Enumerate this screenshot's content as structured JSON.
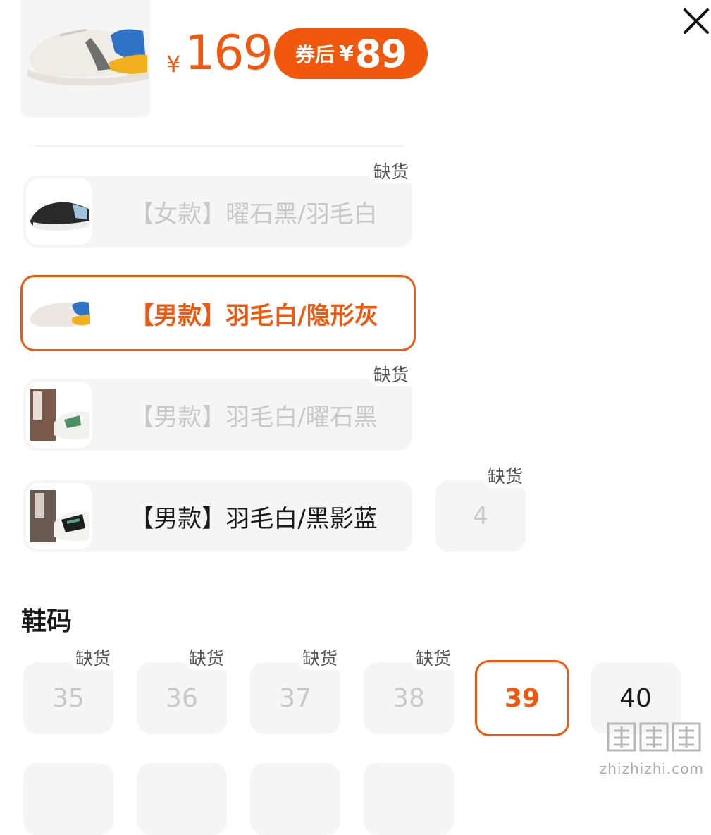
{
  "header": {
    "currency_symbol": "¥",
    "price": "169",
    "coupon_label": "券后",
    "coupon_currency_symbol": "¥",
    "coupon_price": "89"
  },
  "out_of_stock_label": "缺货",
  "variants": [
    {
      "label": "【女款】曜石黑/羽毛白",
      "state": "disabled",
      "out_of_stock": true,
      "thumb": "shoe-black-white"
    },
    {
      "label": "【男款】羽毛白/隐形灰",
      "state": "selected",
      "out_of_stock": false,
      "thumb": "shoe-white-blue-orange"
    },
    {
      "label": "【男款】羽毛白/曜石黑",
      "state": "disabled",
      "out_of_stock": true,
      "thumb": "shoe-worn-white"
    },
    {
      "label": "【男款】羽毛白/黑影蓝",
      "state": "available",
      "out_of_stock": false,
      "thumb": "shoe-worn-green"
    }
  ],
  "extra_variant": {
    "label": "4",
    "state": "disabled",
    "out_of_stock": true
  },
  "size_section": {
    "title": "鞋码",
    "sizes": [
      {
        "label": "35",
        "state": "disabled",
        "out_of_stock": true
      },
      {
        "label": "36",
        "state": "disabled",
        "out_of_stock": true
      },
      {
        "label": "37",
        "state": "disabled",
        "out_of_stock": true
      },
      {
        "label": "38",
        "state": "disabled",
        "out_of_stock": true
      },
      {
        "label": "39",
        "state": "selected",
        "out_of_stock": false
      },
      {
        "label": "40",
        "state": "available",
        "out_of_stock": false
      }
    ]
  },
  "watermark": {
    "text": "zhizhizhi.com",
    "logo": "值值值"
  },
  "colors": {
    "accent": "#f2570e",
    "disabled_text": "#c8c8c8",
    "option_bg": "#f5f5f5"
  },
  "icons": {
    "close": "close-icon"
  }
}
